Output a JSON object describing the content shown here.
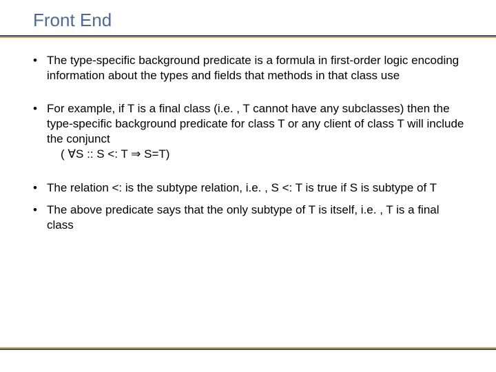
{
  "title": "Front End",
  "bullets": [
    {
      "text": "The type-specific background predicate is a formula in first-order logic encoding information about the types and fields that methods in that class use"
    },
    {
      "text": "For example, if T is a final class (i.e. , T cannot have any subclasses) then the type-specific background predicate for class T or any client of class T will include the conjunct",
      "formula": "( ∀S :: S <: T ⇒ S=T)"
    },
    {
      "text": "The relation <: is the subtype relation, i.e. , S <: T is true if S is subtype of T"
    },
    {
      "text": "The above predicate says that the only subtype of T is itself, i.e. , T is a final class"
    }
  ]
}
